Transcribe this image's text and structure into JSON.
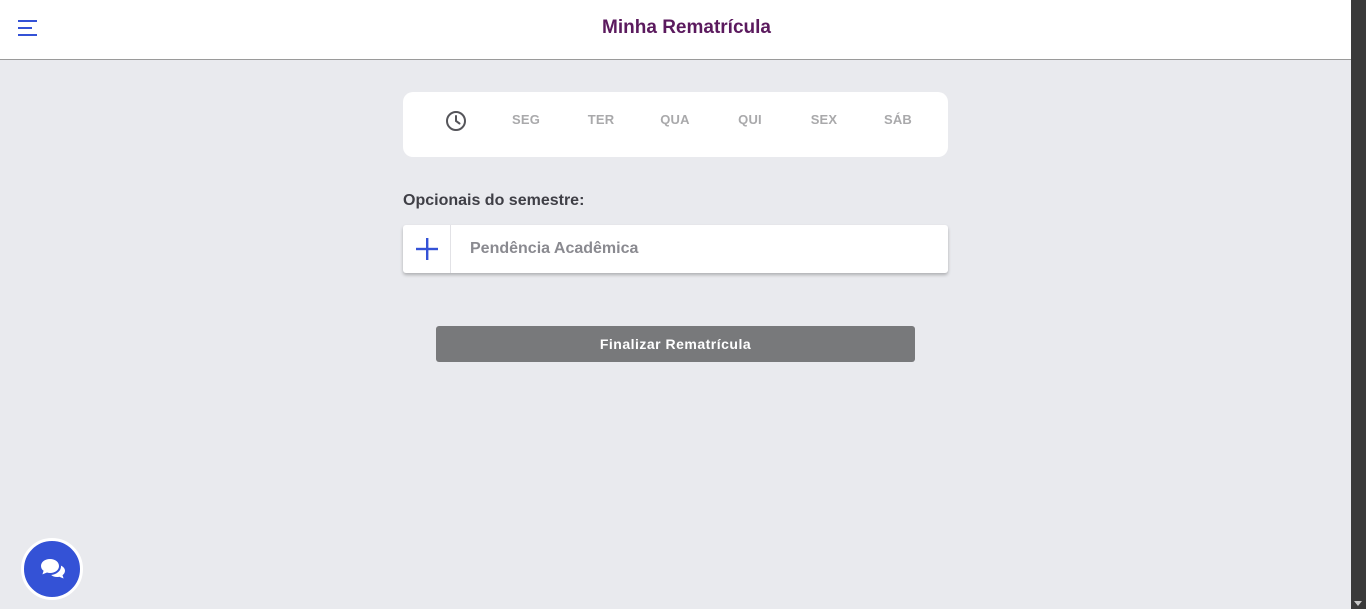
{
  "header": {
    "title": "Minha Rematrícula"
  },
  "schedule": {
    "days": [
      "SEG",
      "TER",
      "QUA",
      "QUI",
      "SEX",
      "SÁB"
    ]
  },
  "optionals": {
    "section_label": "Opcionais do semestre:",
    "items": [
      {
        "label": "Pendência Acadêmica"
      }
    ]
  },
  "actions": {
    "finalize_label": "Finalizar Rematrícula"
  },
  "colors": {
    "title": "#5b1a5e",
    "accent": "#3452d6",
    "background": "#e9eaee",
    "finalize_button": "#78797b"
  },
  "icons": {
    "menu": "menu-icon",
    "clock": "clock-icon",
    "add": "plus-icon",
    "chat": "chat-bubbles-icon"
  }
}
